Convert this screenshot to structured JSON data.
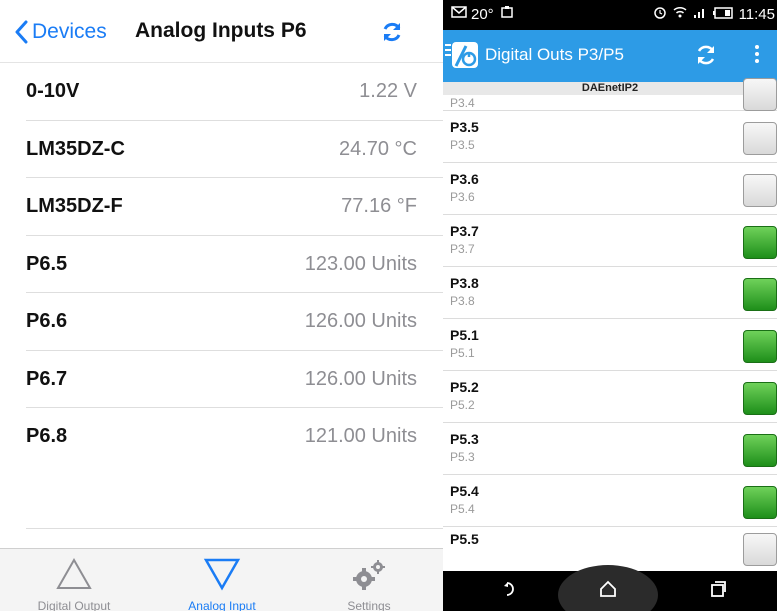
{
  "ios": {
    "nav": {
      "back_label": "Devices",
      "title": "Analog Inputs P6",
      "refresh_icon": "refresh-icon"
    },
    "rows": [
      {
        "label": "0-10V",
        "value": "1.22 V"
      },
      {
        "label": "LM35DZ-C",
        "value": "24.70 °C"
      },
      {
        "label": "LM35DZ-F",
        "value": "77.16 °F"
      },
      {
        "label": "P6.5",
        "value": "123.00 Units"
      },
      {
        "label": "P6.6",
        "value": "126.00 Units"
      },
      {
        "label": "P6.7",
        "value": "126.00 Units"
      },
      {
        "label": "P6.8",
        "value": "121.00 Units"
      }
    ],
    "tabs": [
      {
        "label": "Digital Output",
        "icon": "triangle-up-icon",
        "active": false
      },
      {
        "label": "Analog Input",
        "icon": "triangle-down-icon",
        "active": true
      },
      {
        "label": "Settings",
        "icon": "gear-icon",
        "active": false
      }
    ],
    "accent": "#1a7cf5"
  },
  "android": {
    "status": {
      "temperature": "20°",
      "time": "11:45"
    },
    "action_bar": {
      "title": "Digital Outs P3/P5",
      "color": "#2d9be6"
    },
    "subheader": "DAEnetIP2",
    "rows": [
      {
        "name": "",
        "sub": "P3.4",
        "state": "off"
      },
      {
        "name": "P3.5",
        "sub": "P3.5",
        "state": "off"
      },
      {
        "name": "P3.6",
        "sub": "P3.6",
        "state": "off"
      },
      {
        "name": "P3.7",
        "sub": "P3.7",
        "state": "on"
      },
      {
        "name": "P3.8",
        "sub": "P3.8",
        "state": "on"
      },
      {
        "name": "P5.1",
        "sub": "P5.1",
        "state": "on"
      },
      {
        "name": "P5.2",
        "sub": "P5.2",
        "state": "on"
      },
      {
        "name": "P5.3",
        "sub": "P5.3",
        "state": "on"
      },
      {
        "name": "P5.4",
        "sub": "P5.4",
        "state": "on"
      },
      {
        "name": "P5.5",
        "sub": "",
        "state": ""
      }
    ]
  }
}
